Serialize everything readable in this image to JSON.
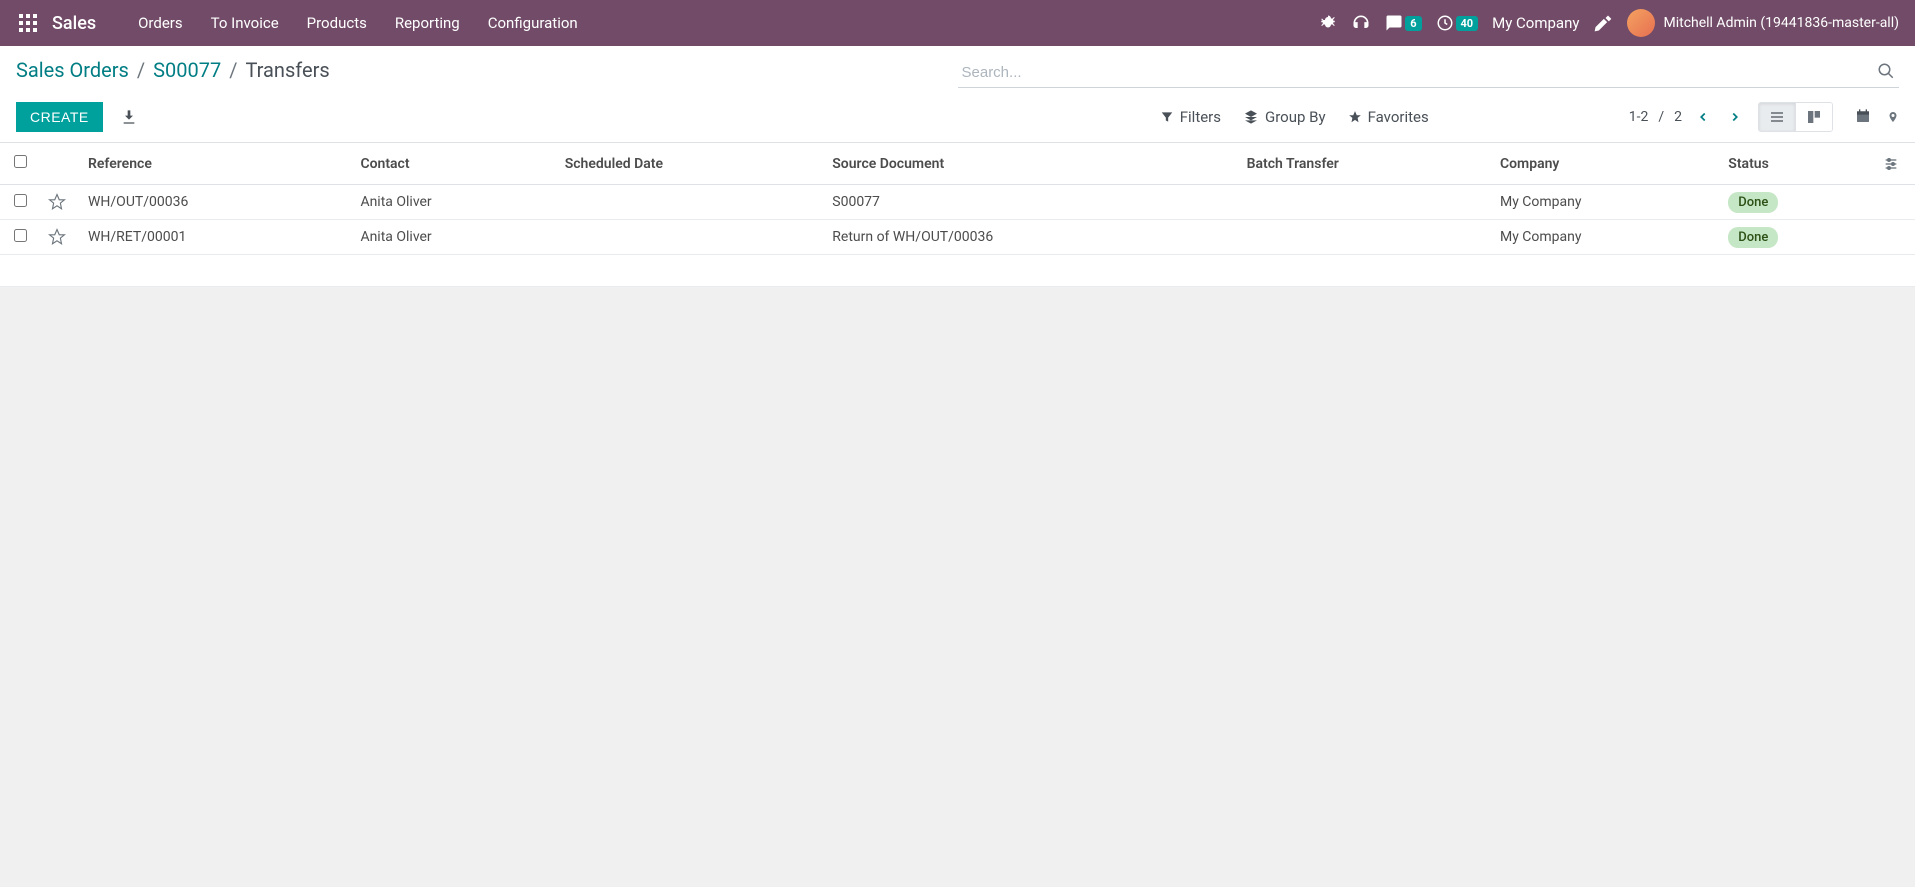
{
  "navbar": {
    "brand": "Sales",
    "menu": [
      "Orders",
      "To Invoice",
      "Products",
      "Reporting",
      "Configuration"
    ],
    "messages_badge": "6",
    "activities_badge": "40",
    "company": "My Company",
    "user": "Mitchell Admin (19441836-master-all)"
  },
  "breadcrumb": {
    "items": [
      "Sales Orders",
      "S00077"
    ],
    "current": "Transfers"
  },
  "search": {
    "placeholder": "Search..."
  },
  "buttons": {
    "create": "CREATE"
  },
  "search_options": {
    "filters": "Filters",
    "group_by": "Group By",
    "favorites": "Favorites"
  },
  "pager": {
    "range": "1-2",
    "sep": "/",
    "total": "2"
  },
  "columns": {
    "reference": "Reference",
    "contact": "Contact",
    "scheduled_date": "Scheduled Date",
    "source_document": "Source Document",
    "batch_transfer": "Batch Transfer",
    "company": "Company",
    "status": "Status"
  },
  "rows": [
    {
      "reference": "WH/OUT/00036",
      "contact": "Anita Oliver",
      "scheduled_date": "",
      "source_document": "S00077",
      "batch_transfer": "",
      "company": "My Company",
      "status": "Done"
    },
    {
      "reference": "WH/RET/00001",
      "contact": "Anita Oliver",
      "scheduled_date": "",
      "source_document": "Return of WH/OUT/00036",
      "batch_transfer": "",
      "company": "My Company",
      "status": "Done"
    }
  ]
}
